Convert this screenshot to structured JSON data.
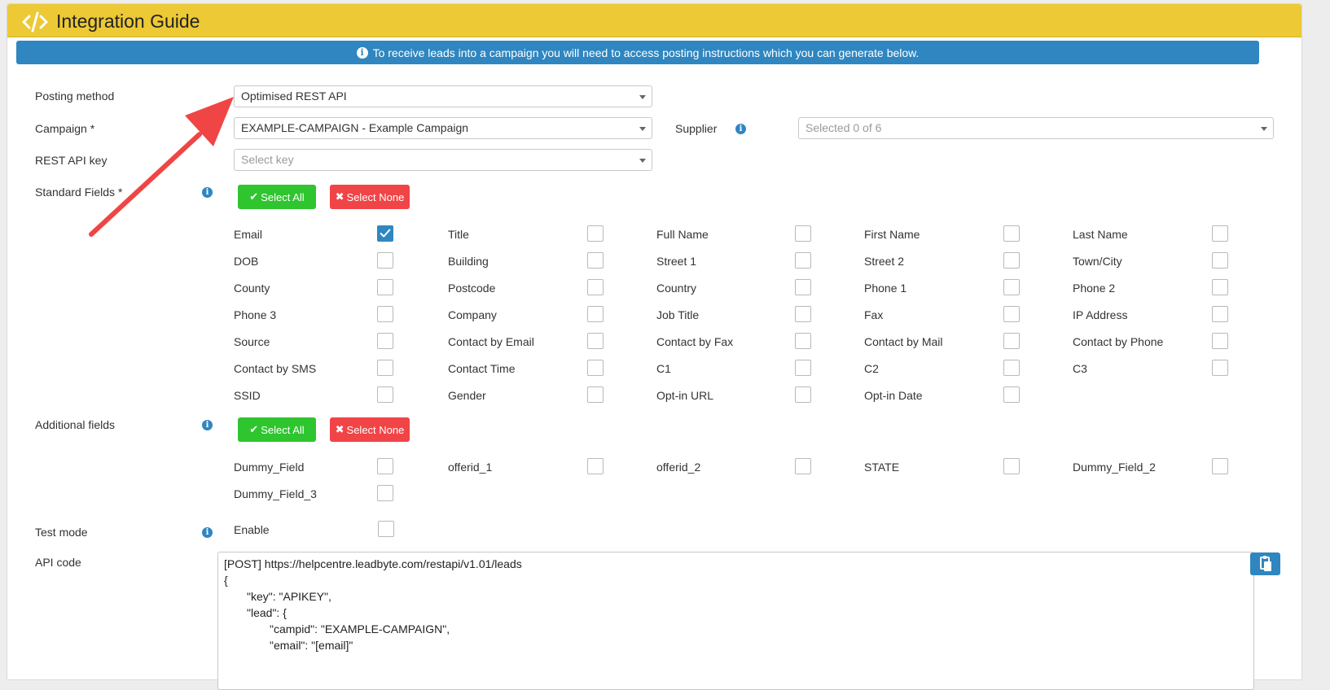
{
  "header": {
    "title": "Integration Guide",
    "icon": "code-icon",
    "color": "#ecc935"
  },
  "info": {
    "text": "To receive leads into a campaign you will need to access posting instructions which you can generate below.",
    "icon": "info-circle-icon",
    "color": "#2f86c0"
  },
  "form": {
    "posting_method": {
      "label": "Posting method",
      "value": "Optimised REST API"
    },
    "campaign": {
      "label": "Campaign *",
      "value": "EXAMPLE-CAMPAIGN - Example Campaign"
    },
    "supplier": {
      "label": "Supplier",
      "placeholder": "Selected 0 of 6"
    },
    "rest_api_key": {
      "label": "REST API key",
      "placeholder": "Select key"
    }
  },
  "standard": {
    "label": "Standard Fields *",
    "select_all": "Select All",
    "select_none": "Select None",
    "fields": [
      {
        "label": "Email",
        "checked": true
      },
      {
        "label": "Title",
        "checked": false
      },
      {
        "label": "Full Name",
        "checked": false
      },
      {
        "label": "First Name",
        "checked": false
      },
      {
        "label": "Last Name",
        "checked": false
      },
      {
        "label": "DOB",
        "checked": false
      },
      {
        "label": "Building",
        "checked": false
      },
      {
        "label": "Street 1",
        "checked": false
      },
      {
        "label": "Street 2",
        "checked": false
      },
      {
        "label": "Town/City",
        "checked": false
      },
      {
        "label": "County",
        "checked": false
      },
      {
        "label": "Postcode",
        "checked": false
      },
      {
        "label": "Country",
        "checked": false
      },
      {
        "label": "Phone 1",
        "checked": false
      },
      {
        "label": "Phone 2",
        "checked": false
      },
      {
        "label": "Phone 3",
        "checked": false
      },
      {
        "label": "Company",
        "checked": false
      },
      {
        "label": "Job Title",
        "checked": false
      },
      {
        "label": "Fax",
        "checked": false
      },
      {
        "label": "IP Address",
        "checked": false
      },
      {
        "label": "Source",
        "checked": false
      },
      {
        "label": "Contact by Email",
        "checked": false
      },
      {
        "label": "Contact by Fax",
        "checked": false
      },
      {
        "label": "Contact by Mail",
        "checked": false
      },
      {
        "label": "Contact by Phone",
        "checked": false
      },
      {
        "label": "Contact by SMS",
        "checked": false
      },
      {
        "label": "Contact Time",
        "checked": false
      },
      {
        "label": "C1",
        "checked": false
      },
      {
        "label": "C2",
        "checked": false
      },
      {
        "label": "C3",
        "checked": false
      },
      {
        "label": "SSID",
        "checked": false
      },
      {
        "label": "Gender",
        "checked": false
      },
      {
        "label": "Opt-in URL",
        "checked": false
      },
      {
        "label": "Opt-in Date",
        "checked": false
      }
    ]
  },
  "additional": {
    "label": "Additional fields",
    "select_all": "Select All",
    "select_none": "Select None",
    "fields": [
      {
        "label": "Dummy_Field",
        "checked": false
      },
      {
        "label": "offerid_1",
        "checked": false
      },
      {
        "label": "offerid_2",
        "checked": false
      },
      {
        "label": "STATE",
        "checked": false
      },
      {
        "label": "Dummy_Field_2",
        "checked": false
      },
      {
        "label": "Dummy_Field_3",
        "checked": false
      }
    ]
  },
  "test_mode": {
    "label": "Test mode",
    "option": "Enable",
    "checked": false
  },
  "api_code": {
    "label": "API code",
    "lines": [
      "[POST] https://helpcentre.leadbyte.com/restapi/v1.01/leads",
      "{",
      "\t\"key\": \"APIKEY\",",
      "\t\"lead\": {",
      "\t\t\"campid\": \"EXAMPLE-CAMPAIGN\",",
      "\t\t\"email\": \"[email]\""
    ],
    "copy_icon": "clipboard-icon"
  }
}
